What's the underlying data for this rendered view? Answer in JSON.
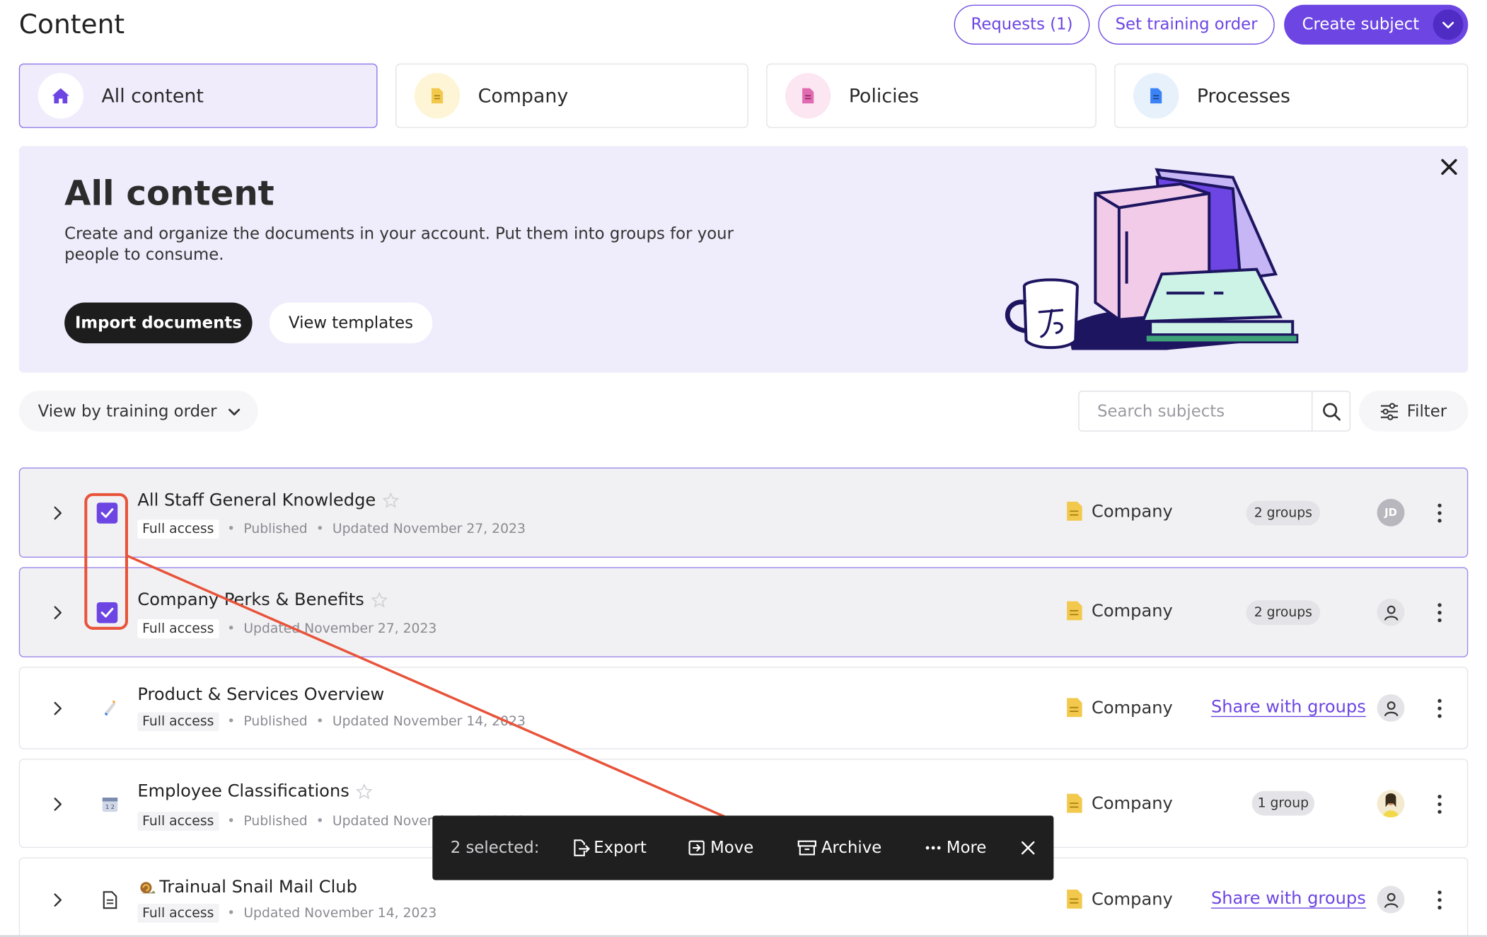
{
  "header": {
    "title": "Content",
    "requests_label": "Requests (1)",
    "training_order_label": "Set training order",
    "create_label": "Create subject"
  },
  "tabs": [
    {
      "label": "All content",
      "icon": "home-icon",
      "color": "#6c45e3"
    },
    {
      "label": "Company",
      "icon": "document-icon",
      "color": "#f2c94c"
    },
    {
      "label": "Policies",
      "icon": "document-icon",
      "color": "#e06bb0"
    },
    {
      "label": "Processes",
      "icon": "document-icon",
      "color": "#3b82f6"
    }
  ],
  "banner": {
    "title": "All content",
    "description": "Create and organize the documents in your account. Put them into groups for your people to consume.",
    "import_label": "Import documents",
    "templates_label": "View templates"
  },
  "toolbar": {
    "view_label": "View by training order",
    "search_placeholder": "Search subjects",
    "filter_label": "Filter"
  },
  "rows": [
    {
      "title": "All Staff General Knowledge",
      "access": "Full access",
      "status": "Published",
      "updated": "Updated November 27, 2023",
      "category": "Company",
      "groups": "2 groups",
      "avatar": "JD",
      "selected": true
    },
    {
      "title": "Company Perks & Benefits",
      "access": "Full access",
      "status": "",
      "updated": "Updated November 27, 2023",
      "category": "Company",
      "groups": "2 groups",
      "avatar": "person-icon",
      "selected": true
    },
    {
      "title": "Product & Services Overview",
      "access": "Full access",
      "status": "Published",
      "updated": "Updated November 14, 2023",
      "category": "Company",
      "groups": "Share with groups",
      "avatar": "person-icon",
      "selected": false
    },
    {
      "title": "Employee Classifications",
      "access": "Full access",
      "status": "Published",
      "updated": "Updated November 13, 2023",
      "category": "Company",
      "groups": "1 group",
      "avatar": "photo",
      "selected": false
    },
    {
      "title": "Trainual Snail Mail Club",
      "access": "Full access",
      "status": "",
      "updated": "Updated November 14, 2023",
      "category": "Company",
      "groups": "Share with groups",
      "avatar": "person-icon",
      "selected": false
    }
  ],
  "selection_bar": {
    "count_label": "2 selected:",
    "export_label": "Export",
    "move_label": "Move",
    "archive_label": "Archive",
    "more_label": "More"
  },
  "colors": {
    "accent": "#6c45e3",
    "annotation": "#e8533a"
  }
}
